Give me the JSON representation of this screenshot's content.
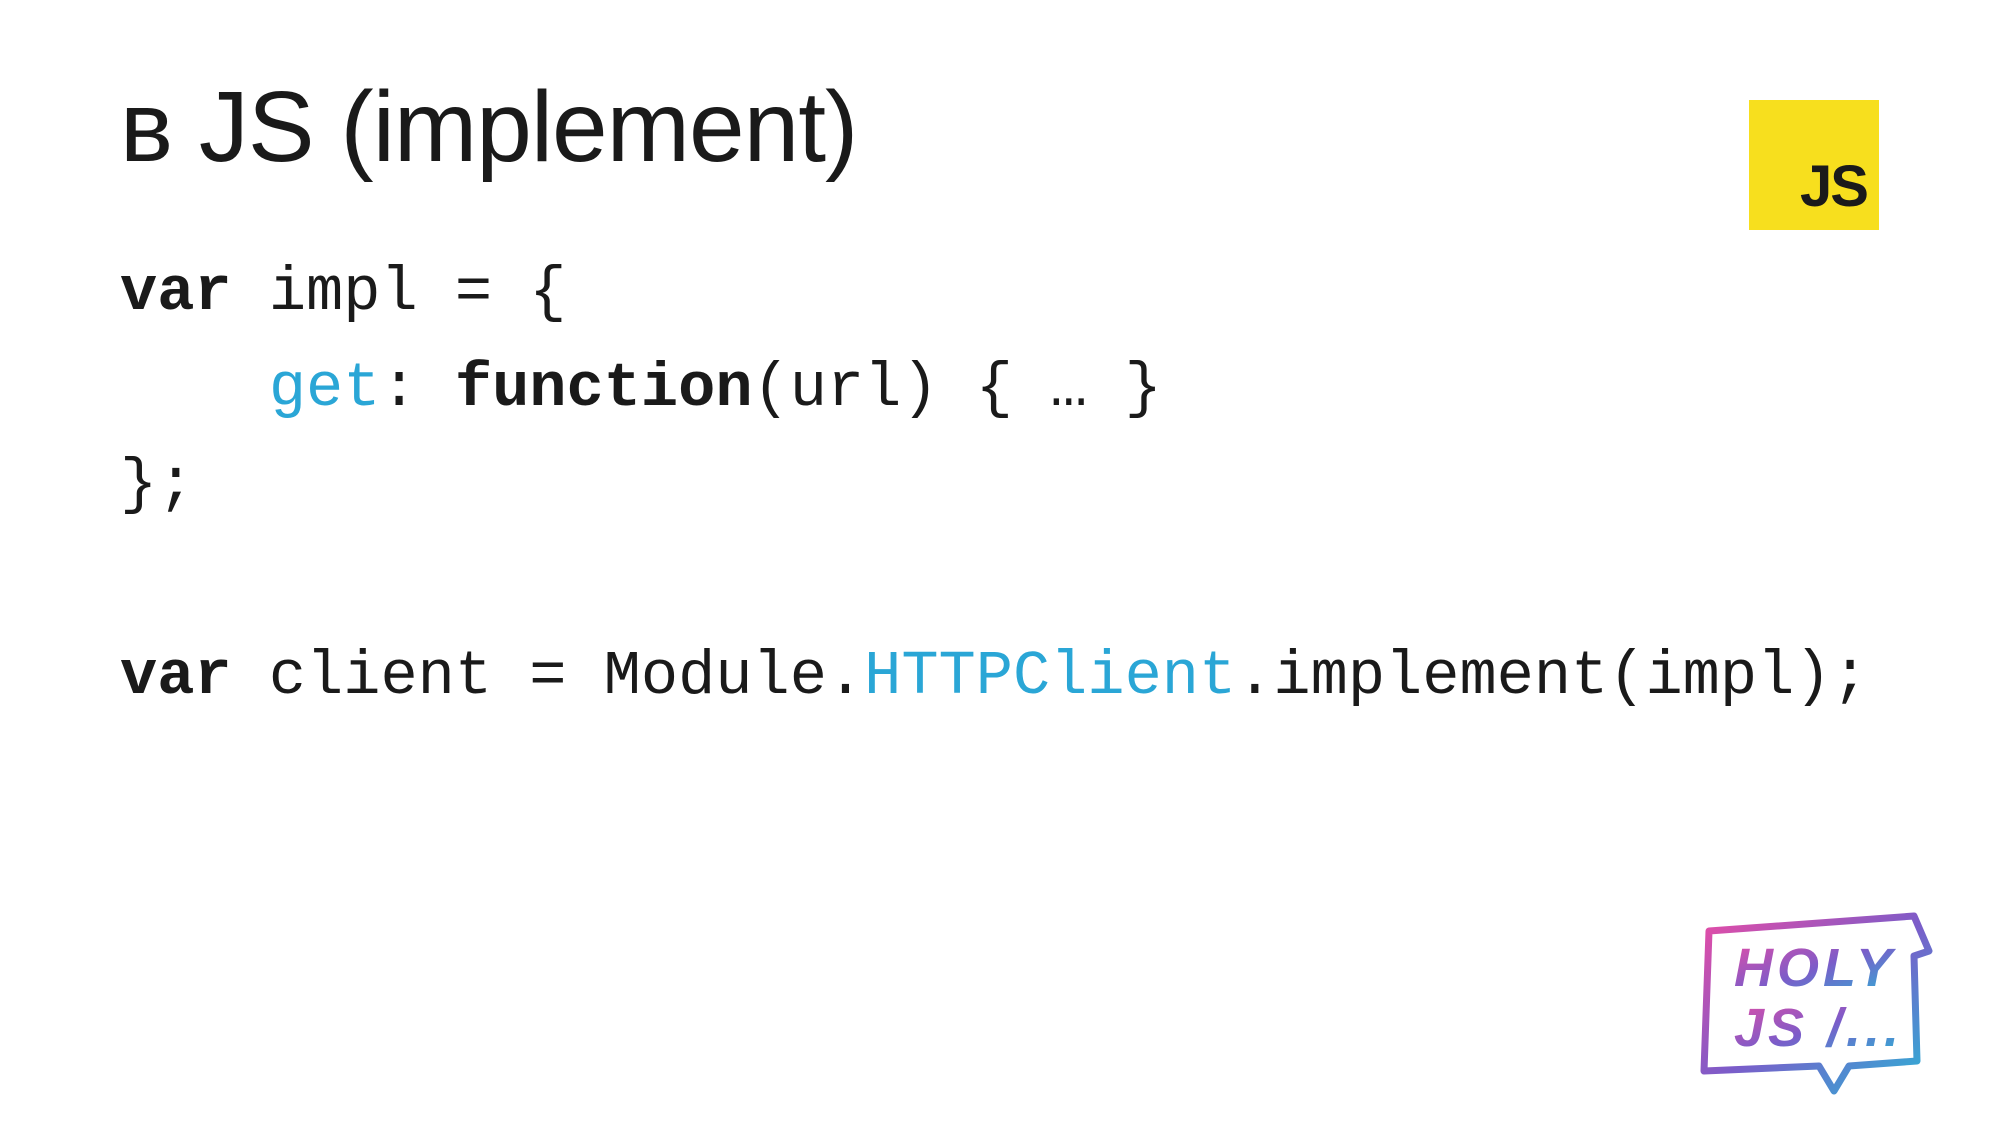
{
  "title": "в JS (implement)",
  "jsBadge": "JS",
  "code": {
    "line1": {
      "kw": "var",
      "rest": " impl = {"
    },
    "line2": {
      "indent": "    ",
      "prop": "get",
      "after": ": ",
      "fn": "function",
      "rest": "(url) { … }"
    },
    "line3": "};",
    "line4": "",
    "line5": {
      "kw": "var",
      "mid1": " client = Module.",
      "hl": "HTTPClient",
      "rest": ".implement(impl);"
    }
  },
  "logo": {
    "line1": "HOLY",
    "line2": "JS /..."
  }
}
